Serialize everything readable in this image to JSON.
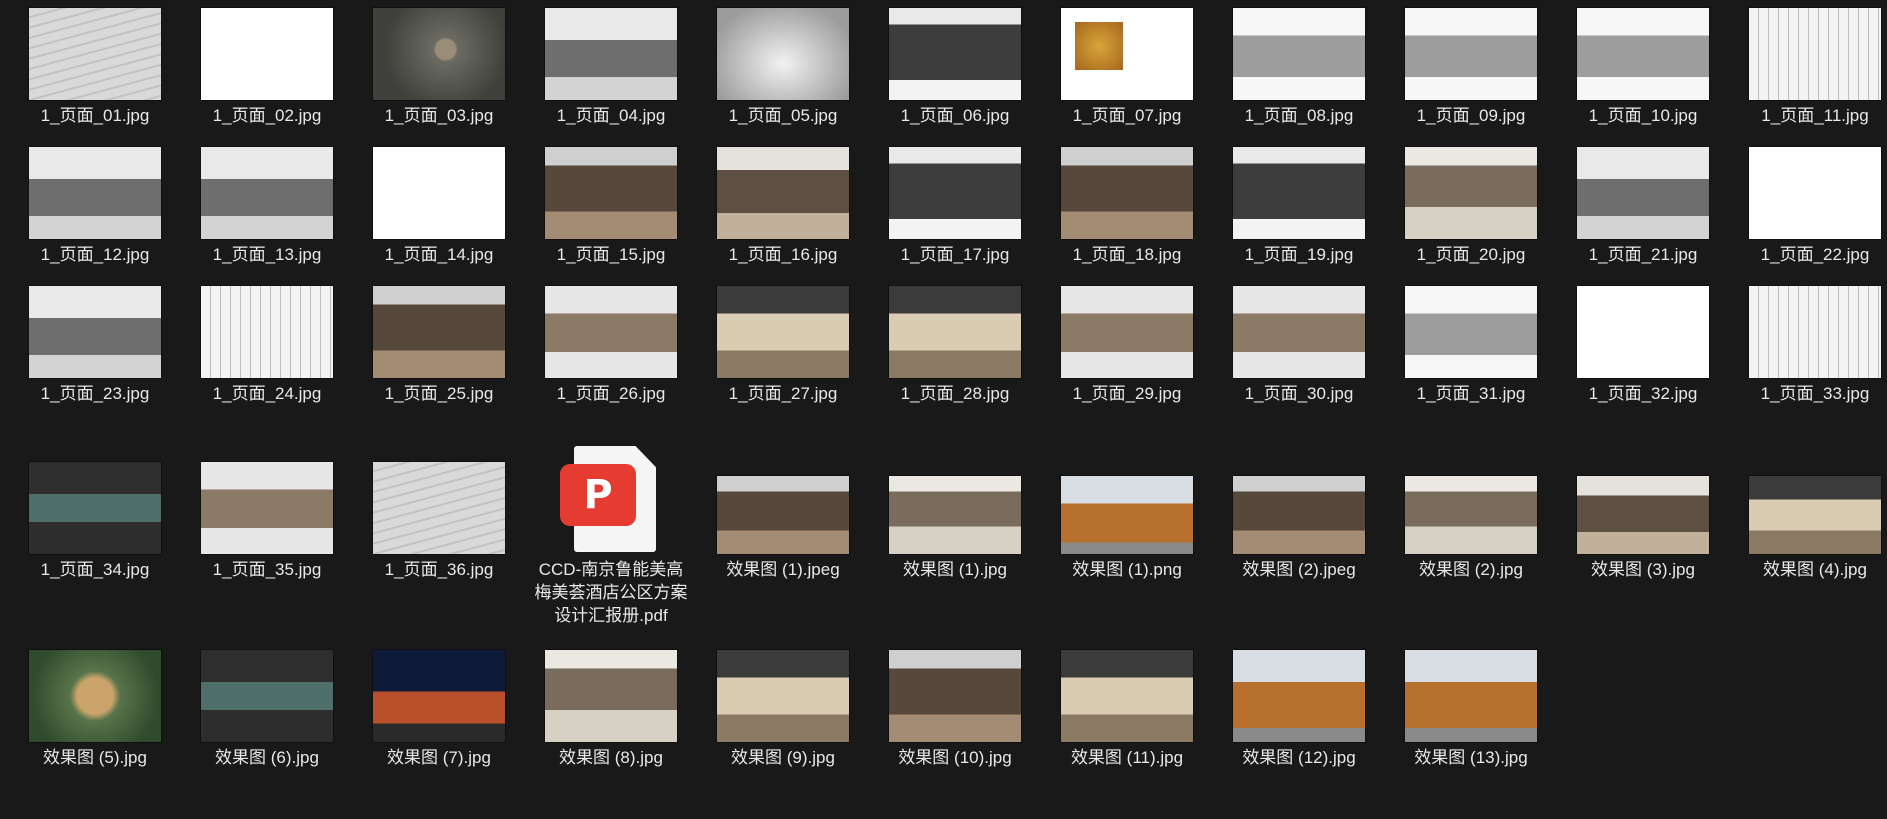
{
  "files": [
    {
      "name": "1_页面_01.jpg",
      "thumb": "roof"
    },
    {
      "name": "1_页面_02.jpg",
      "thumb": "white"
    },
    {
      "name": "1_页面_03.jpg",
      "thumb": "aerial"
    },
    {
      "name": "1_页面_04.jpg",
      "thumb": "mono"
    },
    {
      "name": "1_页面_05.jpg",
      "thumb": "mist"
    },
    {
      "name": "1_页面_06.jpg",
      "thumb": "dark"
    },
    {
      "name": "1_页面_07.jpg",
      "thumb": "gold"
    },
    {
      "name": "1_页面_08.jpg",
      "thumb": "village"
    },
    {
      "name": "1_页面_09.jpg",
      "thumb": "village"
    },
    {
      "name": "1_页面_10.jpg",
      "thumb": "village"
    },
    {
      "name": "1_页面_11.jpg",
      "thumb": "plan"
    },
    {
      "name": "1_页面_12.jpg",
      "thumb": "mono"
    },
    {
      "name": "1_页面_13.jpg",
      "thumb": "mono"
    },
    {
      "name": "1_页面_14.jpg",
      "thumb": "white"
    },
    {
      "name": "1_页面_15.jpg",
      "thumb": "interior"
    },
    {
      "name": "1_页面_16.jpg",
      "thumb": "interior2"
    },
    {
      "name": "1_页面_17.jpg",
      "thumb": "dark"
    },
    {
      "name": "1_页面_18.jpg",
      "thumb": "interior"
    },
    {
      "name": "1_页面_19.jpg",
      "thumb": "dark"
    },
    {
      "name": "1_页面_20.jpg",
      "thumb": "hall"
    },
    {
      "name": "1_页面_21.jpg",
      "thumb": "mono"
    },
    {
      "name": "1_页面_22.jpg",
      "thumb": "white"
    },
    {
      "name": "1_页面_23.jpg",
      "thumb": "mono"
    },
    {
      "name": "1_页面_24.jpg",
      "thumb": "plan"
    },
    {
      "name": "1_页面_25.jpg",
      "thumb": "interior"
    },
    {
      "name": "1_页面_26.jpg",
      "thumb": "strip"
    },
    {
      "name": "1_页面_27.jpg",
      "thumb": "banquet"
    },
    {
      "name": "1_页面_28.jpg",
      "thumb": "banquet"
    },
    {
      "name": "1_页面_29.jpg",
      "thumb": "strip"
    },
    {
      "name": "1_页面_30.jpg",
      "thumb": "strip"
    },
    {
      "name": "1_页面_31.jpg",
      "thumb": "village"
    },
    {
      "name": "1_页面_32.jpg",
      "thumb": "white"
    },
    {
      "name": "1_页面_33.jpg",
      "thumb": "plan"
    },
    {
      "name": "1_页面_34.jpg",
      "thumb": "pool"
    },
    {
      "name": "1_页面_35.jpg",
      "thumb": "strip"
    },
    {
      "name": "1_页面_36.jpg",
      "thumb": "roof"
    },
    {
      "name": "CCD-南京鲁能美高梅美荟酒店公区方案设计汇报册.pdf",
      "thumb": "pdf"
    },
    {
      "name": "效果图 (1).jpeg",
      "thumb": "interior"
    },
    {
      "name": "效果图 (1).jpg",
      "thumb": "hall"
    },
    {
      "name": "效果图 (1).png",
      "thumb": "bldg"
    },
    {
      "name": "效果图 (2).jpeg",
      "thumb": "interior"
    },
    {
      "name": "效果图 (2).jpg",
      "thumb": "hall"
    },
    {
      "name": "效果图 (3).jpg",
      "thumb": "interior2"
    },
    {
      "name": "效果图 (4).jpg",
      "thumb": "banquet"
    },
    {
      "name": "效果图 (5).jpg",
      "thumb": "campus"
    },
    {
      "name": "效果图 (6).jpg",
      "thumb": "pool"
    },
    {
      "name": "效果图 (7).jpg",
      "thumb": "night"
    },
    {
      "name": "效果图 (8).jpg",
      "thumb": "hall"
    },
    {
      "name": "效果图 (9).jpg",
      "thumb": "banquet"
    },
    {
      "name": "效果图 (10).jpg",
      "thumb": "interior"
    },
    {
      "name": "效果图 (11).jpg",
      "thumb": "banquet"
    },
    {
      "name": "效果图 (12).jpg",
      "thumb": "bldg"
    },
    {
      "name": "效果图 (13).jpg",
      "thumb": "bldg"
    }
  ]
}
